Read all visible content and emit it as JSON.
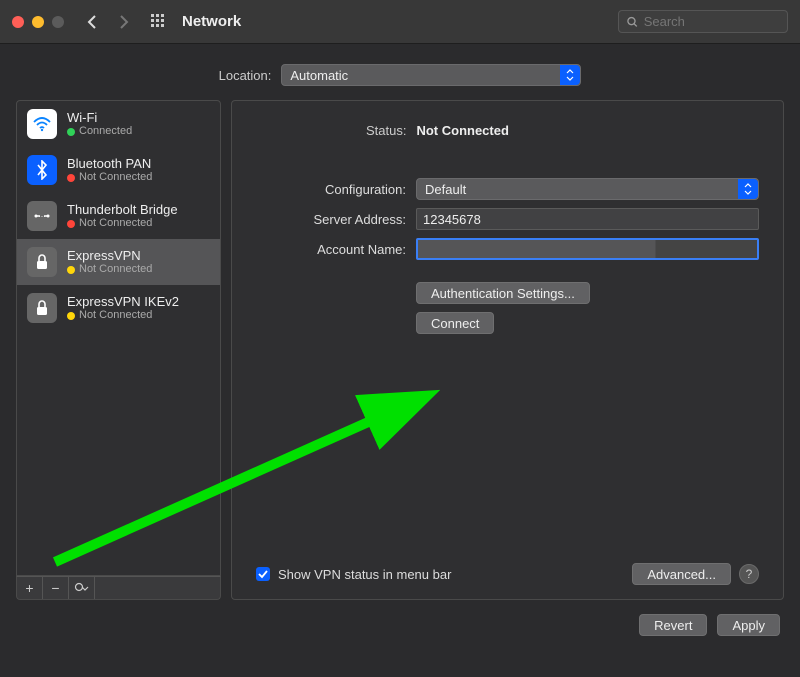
{
  "window": {
    "title": "Network",
    "search_placeholder": "Search"
  },
  "location": {
    "label": "Location:",
    "value": "Automatic"
  },
  "services": [
    {
      "name": "Wi-Fi",
      "status": "Connected",
      "dot": "green",
      "icon": "wifi"
    },
    {
      "name": "Bluetooth PAN",
      "status": "Not Connected",
      "dot": "red",
      "icon": "bt"
    },
    {
      "name": "Thunderbolt Bridge",
      "status": "Not Connected",
      "dot": "red",
      "icon": "tb"
    },
    {
      "name": "ExpressVPN",
      "status": "Not Connected",
      "dot": "yellow",
      "icon": "lock",
      "selected": true
    },
    {
      "name": "ExpressVPN IKEv2",
      "status": "Not Connected",
      "dot": "yellow",
      "icon": "lock"
    }
  ],
  "detail": {
    "status_label": "Status:",
    "status_value": "Not Connected",
    "configuration_label": "Configuration:",
    "configuration_value": "Default",
    "server_address_label": "Server Address:",
    "server_address_value": "12345678",
    "account_name_label": "Account Name:",
    "account_name_value": "",
    "auth_settings_button": "Authentication Settings...",
    "connect_button": "Connect",
    "show_vpn_label": "Show VPN status in menu bar",
    "advanced_button": "Advanced...",
    "help_label": "?"
  },
  "footer": {
    "revert": "Revert",
    "apply": "Apply"
  }
}
